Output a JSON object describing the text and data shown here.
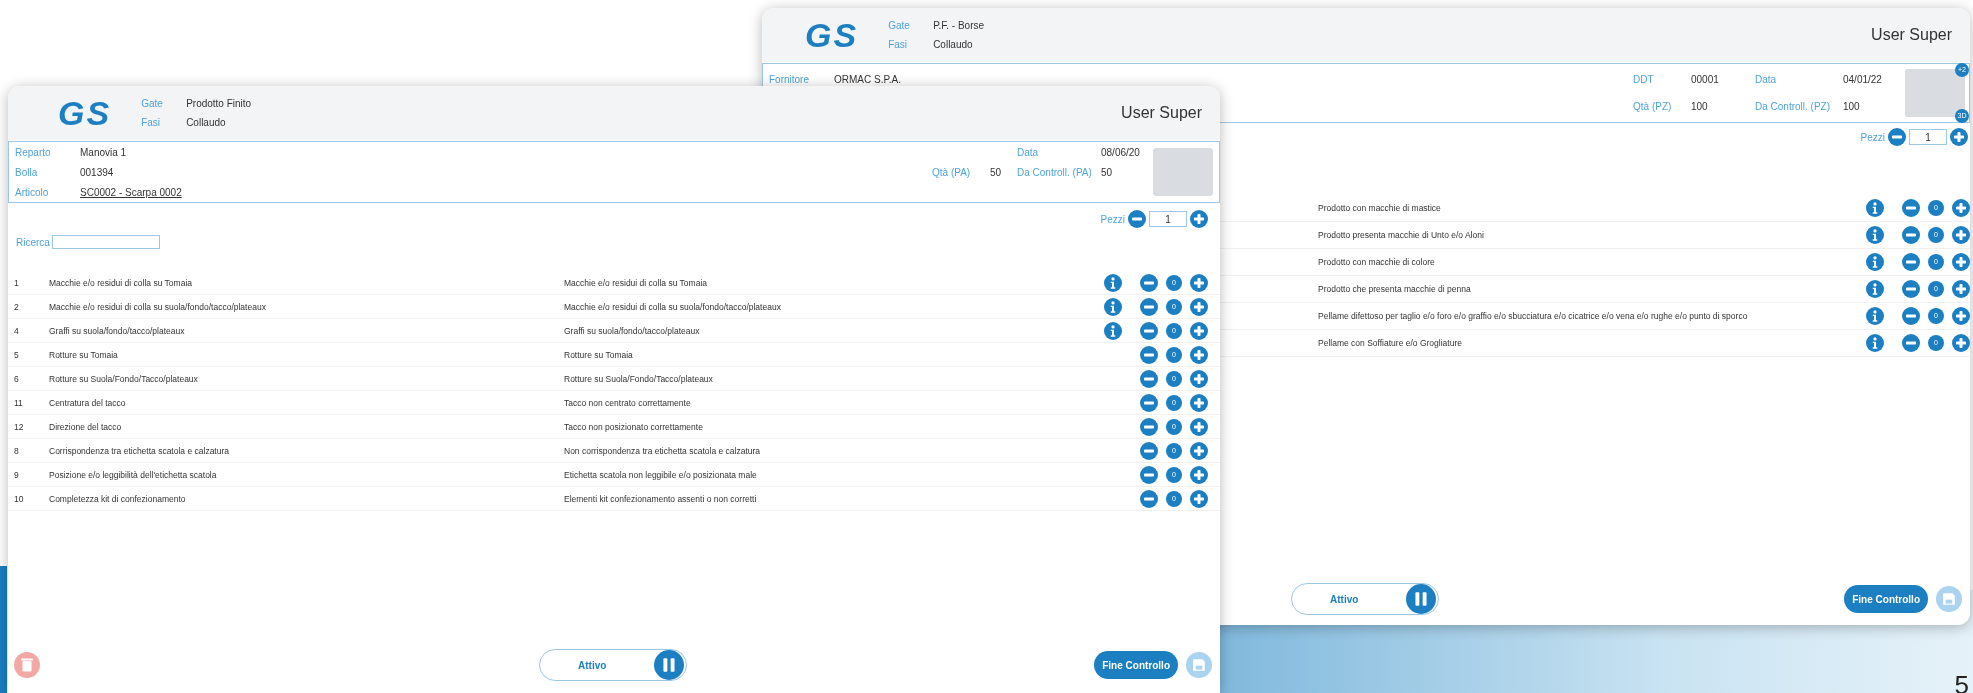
{
  "windows": [
    {
      "logo": "GS",
      "gate_label": "Gate",
      "gate_value": "P.F. - Borse",
      "fasi_label": "Fasi",
      "fasi_value": "Collaudo",
      "user": "User Super",
      "info_rows": [
        {
          "left": {
            "label": "Fornitore",
            "value": "ORMAC S.P.A."
          },
          "middle": {
            "label": "DDT",
            "value": "00001"
          },
          "right": {
            "label": "Data",
            "value": "04/01/22"
          }
        },
        {
          "middle": {
            "label": "Qtà (PZ)",
            "value": "100"
          },
          "right": {
            "label": "Da Controll. (PZ)",
            "value": "100"
          }
        }
      ],
      "image_badges": [
        "+2",
        "3D"
      ],
      "pezzi_label": "Pezzi",
      "pezzi_value": "1",
      "rows": [
        {
          "defect": "Prodotto con macchie di mastice",
          "info": true,
          "count": "0"
        },
        {
          "defect": "Prodotto presenta macchie di Unto e/o Aloni",
          "info": true,
          "count": "0"
        },
        {
          "defect": "Prodotto con macchie di colore",
          "info": true,
          "count": "0"
        },
        {
          "defect": "Prodotto che presenta macchie di penna",
          "info": true,
          "count": "0"
        },
        {
          "defect": "Pellame difettoso per taglio e/o foro e/o graffio e/o sbucciatura e/o cicatrice e/o vena e/o rughe e/o punto di sporco",
          "info": true,
          "count": "0"
        },
        {
          "defect": "Pellame con Soffiature e/o Grogliature",
          "info": true,
          "count": "0"
        }
      ],
      "toggle_label": "Attivo",
      "finish_label": "Fine Controllo",
      "save_disabled": true
    },
    {
      "logo": "GS",
      "gate_label": "Gate",
      "gate_value": "Prodotto Finito",
      "fasi_label": "Fasi",
      "fasi_value": "Collaudo",
      "user": "User Super",
      "info_rows": [
        {
          "left": {
            "label": "Reparto",
            "value": "Manovia 1"
          },
          "right": {
            "label": "Data",
            "value": "08/06/20"
          }
        },
        {
          "left": {
            "label": "Bolla",
            "value": "001394"
          },
          "middle": {
            "label": "Qtà (PA)",
            "value": "50"
          },
          "right": {
            "label": "Da Controll. (PA)",
            "value": "50"
          }
        },
        {
          "left": {
            "label": "Articolo",
            "value": "SC0002 - Scarpa 0002",
            "link": true
          }
        }
      ],
      "pezzi_label": "Pezzi",
      "pezzi_value": "1",
      "search_label": "Ricerca",
      "rows": [
        {
          "number": "1",
          "check": "Macchie e/o residui di colla su Tomaia",
          "defect": "Macchie e/o residui di colla su Tomaia",
          "info": true,
          "count": "0"
        },
        {
          "number": "2",
          "check": "Macchie e/o residui di colla su suola/fondo/tacco/plateaux",
          "defect": "Macchie e/o residui di colla su suola/fondo/tacco/plateaux",
          "info": true,
          "count": "0"
        },
        {
          "number": "4",
          "check": "Graffi su suola/fondo/tacco/plateaux",
          "defect": "Graffi su suola/fondo/tacco/plateaux",
          "info": true,
          "count": "0"
        },
        {
          "number": "5",
          "check": "Rotture su Tomaia",
          "defect": "Rotture su Tomaia",
          "info": false,
          "count": "0"
        },
        {
          "number": "6",
          "check": "Rotture su Suola/Fondo/Tacco/plateaux",
          "defect": "Rotture su Suola/Fondo/Tacco/plateaux",
          "info": false,
          "count": "0"
        },
        {
          "number": "11",
          "check": "Centratura del tacco",
          "defect": "Tacco non centrato correttamente",
          "info": false,
          "count": "0"
        },
        {
          "number": "12",
          "check": "Direzione del tacco",
          "defect": "Tacco non posizionato correttamente",
          "info": false,
          "count": "0"
        },
        {
          "number": "8",
          "check": "Corrispondenza tra etichetta scatola e calzatura",
          "defect": "Non corrispondenza tra etichetta scatola e calzatura",
          "info": false,
          "count": "0"
        },
        {
          "number": "9",
          "check": "Posizione e/o leggibilità dell'etichetta scatola",
          "defect": "Etichetta scatola non leggibile e/o posizionata male",
          "info": false,
          "count": "0"
        },
        {
          "number": "10",
          "check": "Completezza kit di confezionamento",
          "defect": "Elementi kit confezionamento assenti o non corretti",
          "info": false,
          "count": "0"
        }
      ],
      "trash_disabled": true,
      "toggle_label": "Attivo",
      "finish_label": "Fine Controllo",
      "save_disabled": true
    }
  ],
  "page_number": "5"
}
